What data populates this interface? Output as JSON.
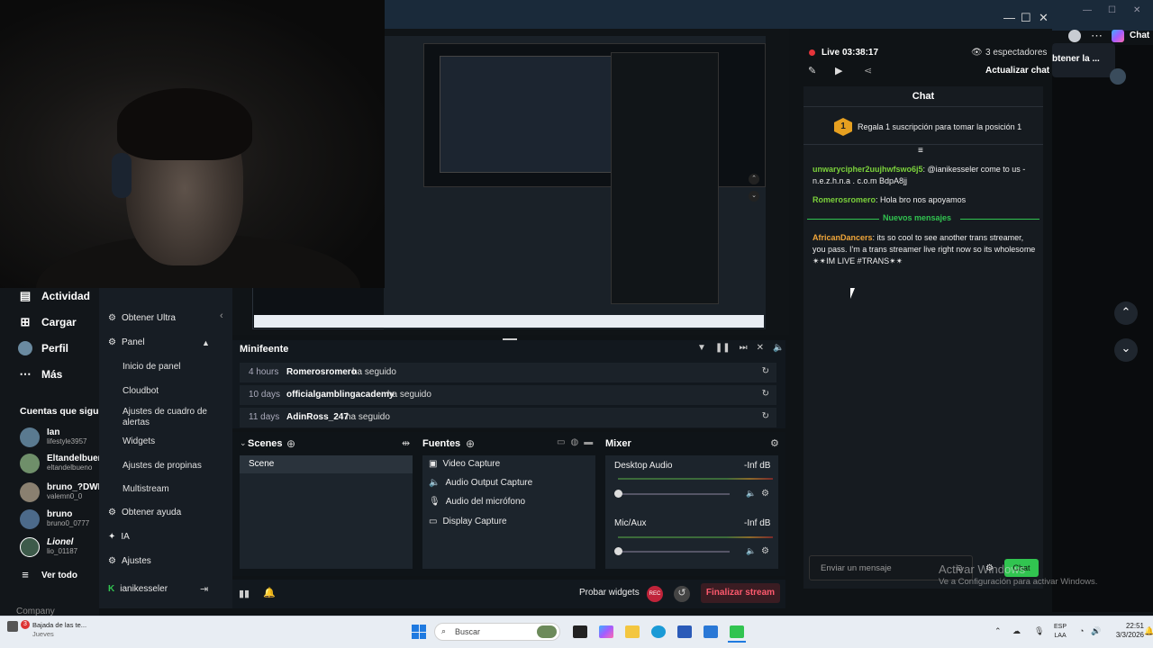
{
  "browser": {
    "tab_label": "Chat",
    "right_snippet": "btener la ..."
  },
  "nav": {
    "items": [
      {
        "label": "Actividad",
        "icon": "activity-icon"
      },
      {
        "label": "Cargar",
        "icon": "upload-icon"
      },
      {
        "label": "Perfil",
        "icon": "profile-icon"
      },
      {
        "label": "Más",
        "icon": "more-icon"
      }
    ],
    "following_title": "Cuentas que sigues",
    "following": [
      {
        "name": "Ian",
        "handle": "lifestyle3957"
      },
      {
        "name": "Eltandelbuen",
        "handle": "eltandelbueno"
      },
      {
        "name": "bruno_?DWR",
        "handle": "valemn0_0"
      },
      {
        "name": "bruno",
        "handle": "bruno0_0777"
      },
      {
        "name": "Lionel",
        "handle": "lio_01187"
      }
    ],
    "see_all": "Ver todo",
    "company": "Company"
  },
  "streamlabs": {
    "menu": {
      "get_ultra": "Obtener Ultra",
      "panel": "Panel",
      "panel_items": [
        "Inicio de panel",
        "Cloudbot",
        "Ajustes de cuadro de alertas",
        "Widgets",
        "Ajustes de propinas",
        "Multistream"
      ],
      "help": "Obtener ayuda",
      "ai": "IA",
      "settings": "Ajustes",
      "account": "ianikesseler"
    },
    "minifeed": {
      "title": "Minifeente",
      "rows": [
        {
          "time": "4 hours",
          "user": "Romerosromero",
          "action": "ha seguido"
        },
        {
          "time": "10 days",
          "user": "officialgamblingacademy",
          "action": "ha seguido"
        },
        {
          "time": "11 days",
          "user": "AdinRoss_247",
          "action": "ha seguido"
        }
      ]
    },
    "scenes": {
      "title": "Scenes",
      "items": [
        "Scene"
      ]
    },
    "sources": {
      "title": "Fuentes",
      "items": [
        "Video Capture",
        "Audio Output Capture",
        "Audio del micrófono",
        "Display Capture"
      ]
    },
    "mixer": {
      "title": "Mixer",
      "channels": [
        {
          "name": "Desktop Audio",
          "level": "-Inf dB",
          "volume": 0
        },
        {
          "name": "Mic/Aux",
          "level": "-Inf dB",
          "volume": 0
        }
      ]
    },
    "bottom": {
      "test_widgets": "Probar widgets",
      "rec": "REC",
      "end_stream": "Finalizar stream"
    }
  },
  "live": {
    "status": "Live",
    "timer": "03:38:17",
    "viewers": "3 espectadores",
    "refresh_chat": "Actualizar chat"
  },
  "chat": {
    "title": "Chat",
    "sub_prompt": "Regala 1 suscripción para tomar la posición 1",
    "rank": "1",
    "messages": [
      {
        "user": "unwarycipher2uujhwfswo6j5",
        "text": ": @ianikesseler come to us - n.e.z.h.n.a . c.o.m BdpA8jj",
        "color": "#7bd13b"
      },
      {
        "user": "Romerosromero",
        "text": ": Hola bro nos apoyamos",
        "color": "#7bd13b"
      }
    ],
    "new_messages_label": "Nuevos mensajes",
    "messages_after": [
      {
        "user": "AfricanDancers",
        "text": ": its so cool to see another trans streamer, you pass. I'm a trans streamer live right now so its wholesome ✴✴IM LIVE #TRANS✴✴",
        "color": "#f0a63a"
      }
    ],
    "input_placeholder": "Enviar un mensaje",
    "send_label": "Chat"
  },
  "watermark": {
    "line1": "Activar Windows",
    "line2": "Ve a Configuración para activar Windows."
  },
  "taskbar": {
    "notification_title": "Bajada de las te...",
    "notification_sub": "Jueves",
    "badge": "3",
    "search_placeholder": "Buscar",
    "lang": "ESP",
    "lang_sub": "LAA",
    "time": "22:51",
    "date": "3/3/2026"
  },
  "colors": {
    "accent_green": "#31c450",
    "live_red": "#e5343a",
    "end_stream": "#ff5a6e"
  }
}
